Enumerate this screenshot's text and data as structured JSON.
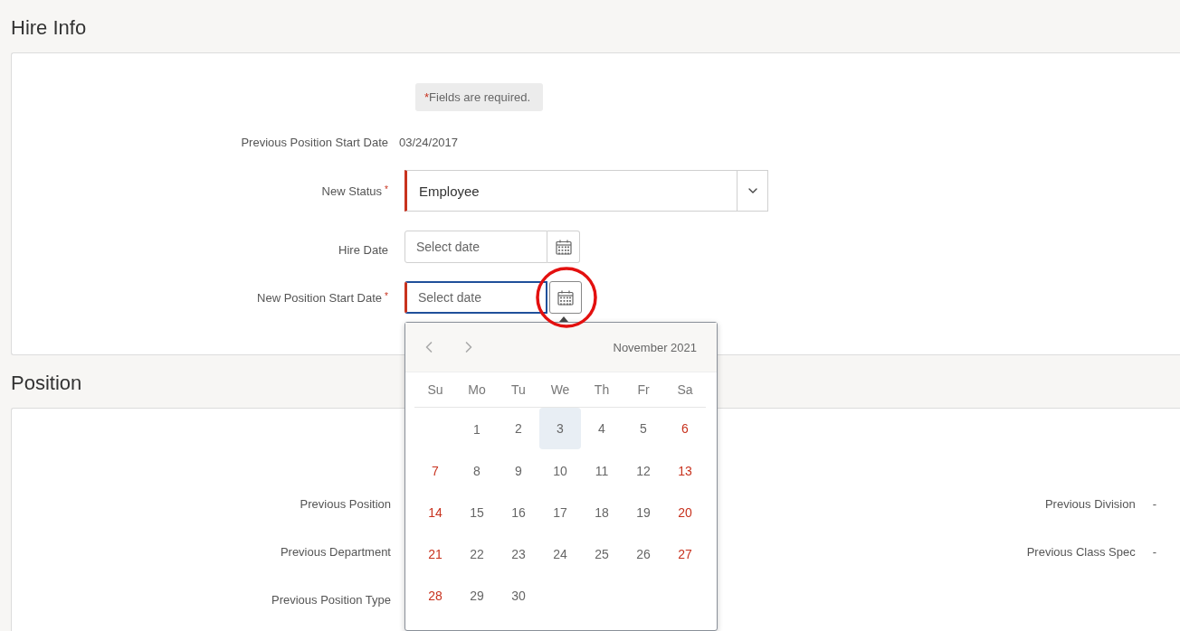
{
  "hire_info": {
    "title": "Hire Info",
    "required_note": {
      "mark": "*",
      "text": "Fields are required."
    },
    "fields": [
      {
        "kind": "text",
        "label": "Previous Position Start Date",
        "value": "03/24/2017"
      },
      {
        "kind": "select",
        "label": "New Status",
        "required": true,
        "value": "Employee"
      },
      {
        "kind": "date",
        "label": "Hire Date",
        "required": false,
        "placeholder": "Select date",
        "focused": false
      },
      {
        "kind": "date",
        "label": "New Position Start Date",
        "required": true,
        "placeholder": "Select date",
        "focused": true
      }
    ]
  },
  "date_picker": {
    "month": "November 2021",
    "weekdays": [
      "Su",
      "Mo",
      "Tu",
      "We",
      "Th",
      "Fr",
      "Sa"
    ],
    "weeks": [
      [
        {
          "day": "1",
          "weekend": false,
          "selected": false
        },
        {
          "day": "2",
          "weekend": false,
          "selected": false
        },
        {
          "day": "3",
          "weekend": false,
          "selected": true
        },
        {
          "day": "4",
          "weekend": false,
          "selected": false
        },
        {
          "day": "5",
          "weekend": false,
          "selected": false
        },
        {
          "day": "6",
          "weekend": true,
          "selected": false
        }
      ],
      [
        {
          "day": "7",
          "weekend": true,
          "selected": false
        },
        {
          "day": "8",
          "weekend": false,
          "selected": false
        },
        {
          "day": "9",
          "weekend": false,
          "selected": false
        },
        {
          "day": "10",
          "weekend": false,
          "selected": false
        },
        {
          "day": "11",
          "weekend": false,
          "selected": false
        },
        {
          "day": "12",
          "weekend": false,
          "selected": false
        },
        {
          "day": "13",
          "weekend": true,
          "selected": false
        }
      ],
      [
        {
          "day": "14",
          "weekend": true,
          "selected": false
        },
        {
          "day": "15",
          "weekend": false,
          "selected": false
        },
        {
          "day": "16",
          "weekend": false,
          "selected": false
        },
        {
          "day": "17",
          "weekend": false,
          "selected": false
        },
        {
          "day": "18",
          "weekend": false,
          "selected": false
        },
        {
          "day": "19",
          "weekend": false,
          "selected": false
        },
        {
          "day": "20",
          "weekend": true,
          "selected": false
        }
      ],
      [
        {
          "day": "21",
          "weekend": true,
          "selected": false
        },
        {
          "day": "22",
          "weekend": false,
          "selected": false
        },
        {
          "day": "23",
          "weekend": false,
          "selected": false
        },
        {
          "day": "24",
          "weekend": false,
          "selected": false
        },
        {
          "day": "25",
          "weekend": false,
          "selected": false
        },
        {
          "day": "26",
          "weekend": false,
          "selected": false
        },
        {
          "day": "27",
          "weekend": true,
          "selected": false
        }
      ],
      [
        {
          "day": "28",
          "weekend": true,
          "selected": false
        },
        {
          "day": "29",
          "weekend": false,
          "selected": false
        },
        {
          "day": "30",
          "weekend": false,
          "selected": false
        }
      ]
    ]
  },
  "position": {
    "title": "Position",
    "left_fields": [
      {
        "label": "Previous Position"
      },
      {
        "label": "Previous Department"
      },
      {
        "label": "Previous Position Type"
      }
    ],
    "right_fields": [
      {
        "label": "Previous Division",
        "value": "-"
      },
      {
        "label": "Previous Class Spec",
        "value": "-"
      }
    ]
  }
}
